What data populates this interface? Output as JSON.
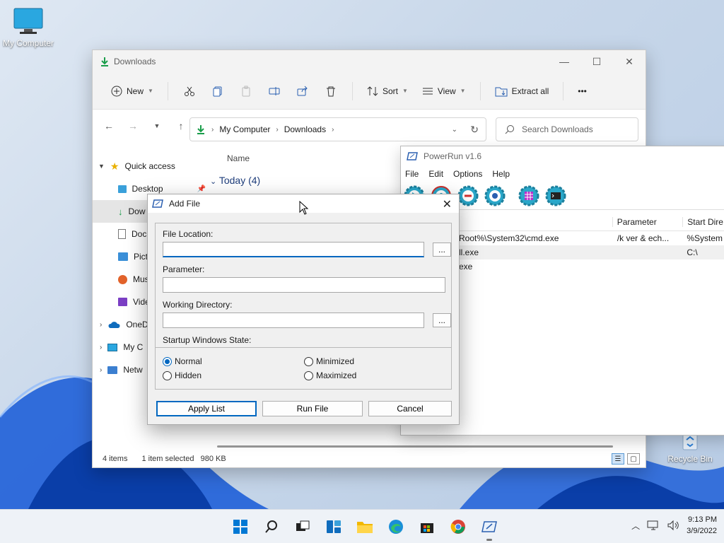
{
  "desktop": {
    "icons": [
      {
        "label": "My Computer"
      },
      {
        "label": "Recycle Bin"
      }
    ]
  },
  "explorer": {
    "title": "Downloads",
    "toolbar": {
      "new_label": "New",
      "sort_label": "Sort",
      "view_label": "View",
      "extract_label": "Extract all",
      "more_label": "•••"
    },
    "breadcrumb": [
      "My Computer",
      "Downloads"
    ],
    "search_placeholder": "Search Downloads",
    "nav": [
      {
        "label": "Quick access"
      },
      {
        "label": "Desktop"
      },
      {
        "label": "Dow"
      },
      {
        "label": "Doc"
      },
      {
        "label": "Pict"
      },
      {
        "label": "Mus"
      },
      {
        "label": "Vide"
      },
      {
        "label": "OneD"
      },
      {
        "label": "My C"
      },
      {
        "label": "Netw"
      }
    ],
    "column_name": "Name",
    "group_header": "Today (4)",
    "status": {
      "items": "4 items",
      "selected": "1 item selected",
      "size": "980 KB"
    }
  },
  "powerrun": {
    "title": "PowerRun v1.6",
    "menu": [
      "File",
      "Edit",
      "Options",
      "Help"
    ],
    "columns": [
      "",
      "Parameter",
      "Start Dire"
    ],
    "rows": [
      {
        "c1": "Root%\\System32\\cmd.exe",
        "c2": "/k ver & ech...",
        "c3": "%System"
      },
      {
        "c1": "ll.exe",
        "c2": "",
        "c3": "C:\\"
      },
      {
        "c1": "exe",
        "c2": "",
        "c3": ""
      }
    ]
  },
  "dialog": {
    "title": "Add File",
    "file_location_label": "File Location:",
    "file_location_value": "",
    "parameter_label": "Parameter:",
    "parameter_value": "",
    "working_dir_label": "Working Directory:",
    "working_dir_value": "",
    "browse_label": "...",
    "startup_label": "Startup Windows State:",
    "radios": {
      "normal": "Normal",
      "hidden": "Hidden",
      "minimized": "Minimized",
      "maximized": "Maximized",
      "selected": "Normal"
    },
    "buttons": {
      "apply": "Apply List",
      "run": "Run File",
      "cancel": "Cancel"
    }
  },
  "taskbar": {
    "time": "9:13 PM",
    "date": "3/9/2022"
  },
  "colors": {
    "accent": "#0067c0",
    "folder_green": "#1a9d4a",
    "gear_teal": "#2aa7c9"
  }
}
